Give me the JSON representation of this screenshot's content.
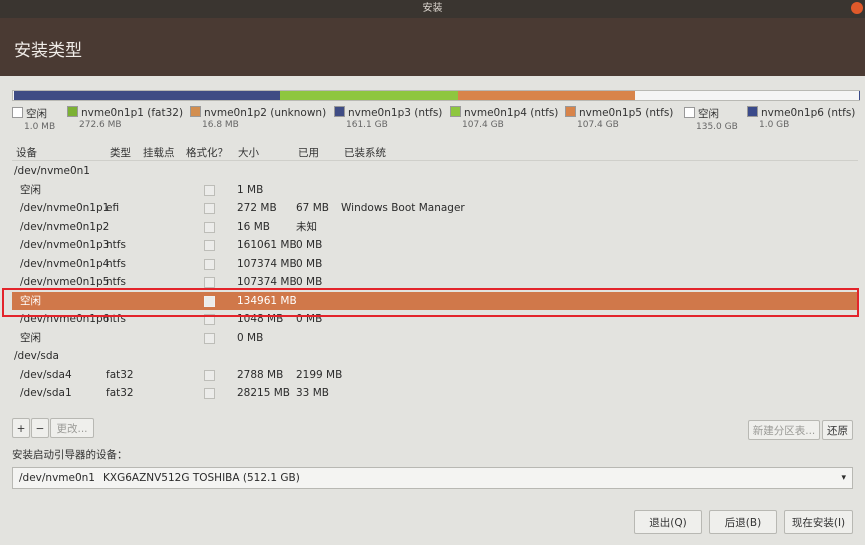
{
  "window": {
    "title": "安装"
  },
  "page": {
    "title": "安装类型"
  },
  "partitions_bar": [
    {
      "color": "#f5f5f5",
      "fraction": 0.001
    },
    {
      "color": "#7cb134",
      "fraction": 0.0005
    },
    {
      "color": "#d28e4f",
      "fraction": 0.0001
    },
    {
      "color": "#3f4c84",
      "fraction": 0.314
    },
    {
      "color": "#8ec63f",
      "fraction": 0.21
    },
    {
      "color": "#d8844a",
      "fraction": 0.21
    },
    {
      "color": "#f5f5f5",
      "fraction": 0.264
    },
    {
      "color": "#3a4a8a",
      "fraction": 0.0002
    }
  ],
  "legend": [
    {
      "name": "空闲",
      "size": "1.0 MB",
      "color": "#ffffff"
    },
    {
      "name": "nvme0n1p1 (fat32)",
      "size": "272.6 MB",
      "color": "#7cb134"
    },
    {
      "name": "nvme0n1p2 (unknown)",
      "size": "16.8 MB",
      "color": "#d28e4f"
    },
    {
      "name": "nvme0n1p3 (ntfs)",
      "size": "161.1 GB",
      "color": "#3f4c84"
    },
    {
      "name": "nvme0n1p4 (ntfs)",
      "size": "107.4 GB",
      "color": "#8ec63f"
    },
    {
      "name": "nvme0n1p5 (ntfs)",
      "size": "107.4 GB",
      "color": "#d8844a"
    },
    {
      "name": "空闲",
      "size": "135.0 GB",
      "color": "#ffffff"
    },
    {
      "name": "nvme0n1p6 (ntfs)",
      "size": "1.0 GB",
      "color": "#3a4a8a"
    }
  ],
  "table": {
    "headers": {
      "device": "设备",
      "type": "类型",
      "mount": "挂载点",
      "format": "格式化？",
      "size": "大小",
      "used": "已用",
      "system": "已装系统"
    },
    "rows": [
      {
        "device": "/dev/nvme0n1",
        "type": "",
        "size": "",
        "used": "",
        "system": "",
        "check": false,
        "group": true
      },
      {
        "device": "空闲",
        "type": "",
        "size": "1 MB",
        "used": "",
        "system": "",
        "check": true
      },
      {
        "device": "/dev/nvme0n1p1",
        "type": "efi",
        "size": "272 MB",
        "used": "67 MB",
        "system": "Windows Boot Manager",
        "check": true
      },
      {
        "device": "/dev/nvme0n1p2",
        "type": "",
        "size": "16 MB",
        "used": "未知",
        "system": "",
        "check": true
      },
      {
        "device": "/dev/nvme0n1p3",
        "type": "ntfs",
        "size": "161061 MB",
        "used": "0 MB",
        "system": "",
        "check": true
      },
      {
        "device": "/dev/nvme0n1p4",
        "type": "ntfs",
        "size": "107374 MB",
        "used": "0 MB",
        "system": "",
        "check": true
      },
      {
        "device": "/dev/nvme0n1p5",
        "type": "ntfs",
        "size": "107374 MB",
        "used": "0 MB",
        "system": "",
        "check": true
      },
      {
        "device": "空闲",
        "type": "",
        "size": "134961 MB",
        "used": "",
        "system": "",
        "check": true,
        "selected": true
      },
      {
        "device": "/dev/nvme0n1p6",
        "type": "ntfs",
        "size": "1048 MB",
        "used": "0 MB",
        "system": "",
        "check": true
      },
      {
        "device": "空闲",
        "type": "",
        "size": "0 MB",
        "used": "",
        "system": "",
        "check": true
      },
      {
        "device": "/dev/sda",
        "type": "",
        "size": "",
        "used": "",
        "system": "",
        "check": false,
        "group": true
      },
      {
        "device": "/dev/sda4",
        "type": "fat32",
        "size": "2788 MB",
        "used": "2199 MB",
        "system": "",
        "check": true
      },
      {
        "device": "/dev/sda1",
        "type": "fat32",
        "size": "28215 MB",
        "used": "33 MB",
        "system": "",
        "check": true
      }
    ]
  },
  "toolbar": {
    "add": "+",
    "remove": "−",
    "change": "更改...",
    "new_table": "新建分区表...",
    "revert": "还原"
  },
  "boot": {
    "label": "安装启动引导器的设备：",
    "device": "/dev/nvme0n1",
    "model": "KXG6AZNV512G TOSHIBA (512.1 GB)"
  },
  "buttons": {
    "quit": "退出(Q)",
    "back": "后退(B)",
    "install": "现在安装(I)"
  }
}
